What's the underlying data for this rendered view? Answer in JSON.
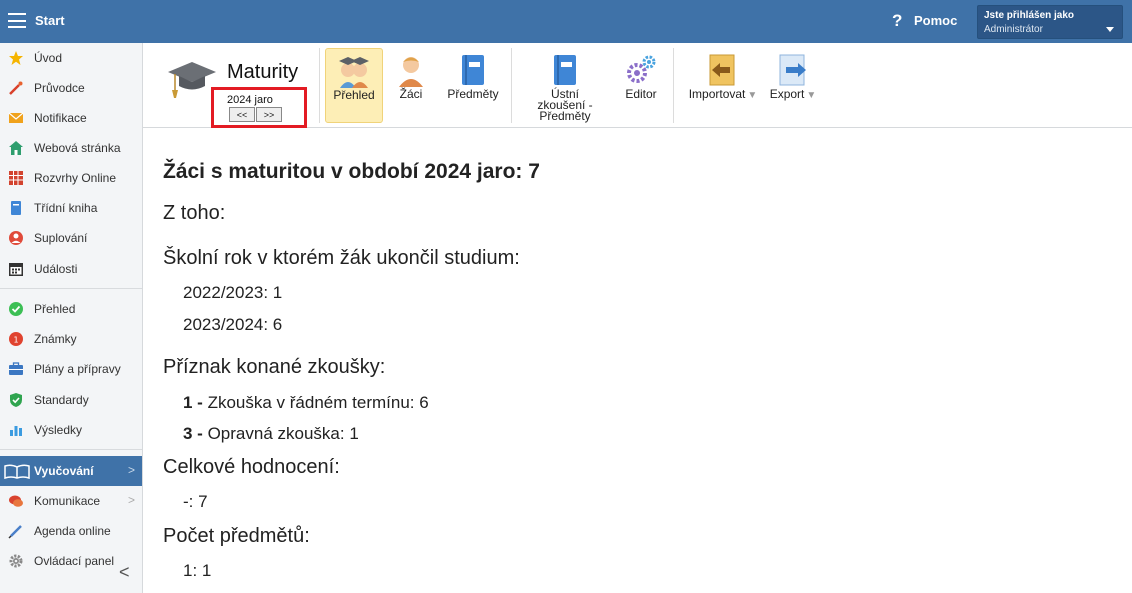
{
  "topbar": {
    "start_label": "Start",
    "help_label": "Pomoc",
    "user_line1": "Jste přihlášen jako",
    "user_line2": "Administrátor"
  },
  "sidebar": {
    "items": [
      {
        "label": "Úvod",
        "icon": "star-icon"
      },
      {
        "label": "Průvodce",
        "icon": "wand-icon"
      },
      {
        "label": "Notifikace",
        "icon": "envelope-icon"
      },
      {
        "label": "Webová stránka",
        "icon": "home-icon"
      },
      {
        "label": "Rozvrhy Online",
        "icon": "calendar-grid-icon"
      },
      {
        "label": "Třídní kniha",
        "icon": "book-icon"
      },
      {
        "label": "Suplování",
        "icon": "person-icon"
      },
      {
        "label": "Události",
        "icon": "calendar-icon"
      },
      {
        "label": "Přehled",
        "icon": "check-circle-icon"
      },
      {
        "label": "Známky",
        "icon": "grade-icon"
      },
      {
        "label": "Plány a přípravy",
        "icon": "briefcase-icon"
      },
      {
        "label": "Standardy",
        "icon": "shield-icon"
      },
      {
        "label": "Výsledky",
        "icon": "bar-chart-icon"
      },
      {
        "label": "Vyučování",
        "icon": "open-book-icon"
      },
      {
        "label": "Komunikace",
        "icon": "chat-icon"
      },
      {
        "label": "Agenda online",
        "icon": "pen-icon"
      },
      {
        "label": "Ovládací panel",
        "icon": "gear-icon"
      }
    ]
  },
  "toolbar": {
    "module_title": "Maturity",
    "period": "2024 jaro",
    "prev_label": "<<",
    "next_label": ">>",
    "buttons": [
      {
        "label": "Přehled"
      },
      {
        "label": "Žáci"
      },
      {
        "label": "Předměty"
      },
      {
        "label": "Ústní zkoušení - Předměty"
      },
      {
        "label": "Editor"
      },
      {
        "label": "Importovat"
      },
      {
        "label": "Export"
      }
    ]
  },
  "content": {
    "heading": "Žáci s maturitou v období 2024 jaro: 7",
    "z_toho": "Z toho:",
    "sections": [
      {
        "title": "Školní rok v ktorém žák ukončil studium:",
        "values": [
          "2022/2023: 1",
          "2023/2024: 6"
        ]
      },
      {
        "title": "Příznak konané zkoušky:",
        "values": [
          {
            "code": "1 -",
            "text": "Zkouška v řádném termínu: 6"
          },
          {
            "code": "3 -",
            "text": "Opravná zkouška: 1"
          }
        ]
      },
      {
        "title": "Celkové hodnocení:",
        "values": [
          "-: 7"
        ]
      },
      {
        "title": "Počet předmětů:",
        "values": [
          "1: 1"
        ]
      }
    ]
  },
  "colors": {
    "topbar": "#3f72a8",
    "active_tab": "#fdeeb6",
    "highlight_box": "#e31b23"
  }
}
